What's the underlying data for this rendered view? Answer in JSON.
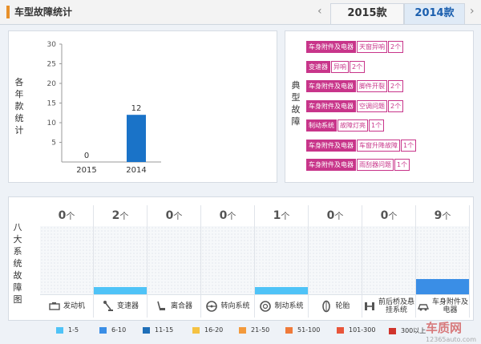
{
  "header": {
    "title": "车型故障统计"
  },
  "tabs": {
    "prev": "‹",
    "next": "›",
    "items": [
      "2015款",
      "2014款"
    ],
    "active": "2014款"
  },
  "yearly": {
    "label": [
      "各",
      "年",
      "款",
      "统",
      "计"
    ],
    "chart_data": {
      "type": "bar",
      "categories": [
        "2015",
        "2014"
      ],
      "values": [
        0,
        12
      ],
      "yticks": [
        5,
        10,
        15,
        20,
        25,
        30
      ],
      "ylim": [
        0,
        30
      ],
      "color": "#1a73c8"
    }
  },
  "typical": {
    "label": [
      "典",
      "型",
      "故",
      "障"
    ],
    "items": [
      {
        "category": "车身附件及电器",
        "issue": "天窗异响",
        "count": "2个"
      },
      {
        "category": "变速器",
        "issue": "异响",
        "count": "2个"
      },
      {
        "category": "车身附件及电器",
        "issue": "脚件开裂",
        "count": "2个"
      },
      {
        "category": "车身附件及电器",
        "issue": "空调问题",
        "count": "2个"
      },
      {
        "category": "制动系统",
        "issue": "故障灯亮",
        "count": "1个"
      },
      {
        "category": "车身附件及电器",
        "issue": "车窗升降故障",
        "count": "1个"
      },
      {
        "category": "车身附件及电器",
        "issue": "雨刮器问题",
        "count": "1个"
      }
    ]
  },
  "systems": {
    "label": [
      "八",
      "大",
      "系",
      "统",
      "故",
      "障",
      "图"
    ],
    "unit": "个",
    "items": [
      {
        "name": "发动机",
        "count": "0",
        "level": 0,
        "color": "#4fc3f7",
        "icon": "engine-icon"
      },
      {
        "name": "变速器",
        "count": "2",
        "level": 0.12,
        "color": "#4fc3f7",
        "icon": "gear-shift-icon"
      },
      {
        "name": "离合器",
        "count": "0",
        "level": 0,
        "color": "#4fc3f7",
        "icon": "clutch-icon"
      },
      {
        "name": "转向系统",
        "count": "0",
        "level": 0,
        "color": "#4fc3f7",
        "icon": "steering-wheel-icon"
      },
      {
        "name": "制动系统",
        "count": "1",
        "level": 0.12,
        "color": "#4fc3f7",
        "icon": "brake-icon"
      },
      {
        "name": "轮胎",
        "count": "0",
        "level": 0,
        "color": "#4fc3f7",
        "icon": "tire-icon"
      },
      {
        "name": "前后桥及悬挂系统",
        "count": "0",
        "level": 0,
        "color": "#4fc3f7",
        "icon": "suspension-icon"
      },
      {
        "name": "车身附件及电器",
        "count": "9",
        "level": 0.23,
        "color": "#3a8ee6",
        "icon": "car-body-icon"
      }
    ]
  },
  "legend": [
    {
      "range": "1-5",
      "color": "#4fc3f7"
    },
    {
      "range": "6-10",
      "color": "#3a8ee6"
    },
    {
      "range": "11-15",
      "color": "#1f6fb8"
    },
    {
      "range": "16-20",
      "color": "#f5c242"
    },
    {
      "range": "21-50",
      "color": "#f39a3c"
    },
    {
      "range": "51-100",
      "color": "#ef7a3a"
    },
    {
      "range": "101-300",
      "color": "#e8553a"
    },
    {
      "range": "300以上",
      "color": "#d0342c"
    }
  ],
  "watermark": {
    "brand": "车质网",
    "url": "12365auto.com"
  }
}
